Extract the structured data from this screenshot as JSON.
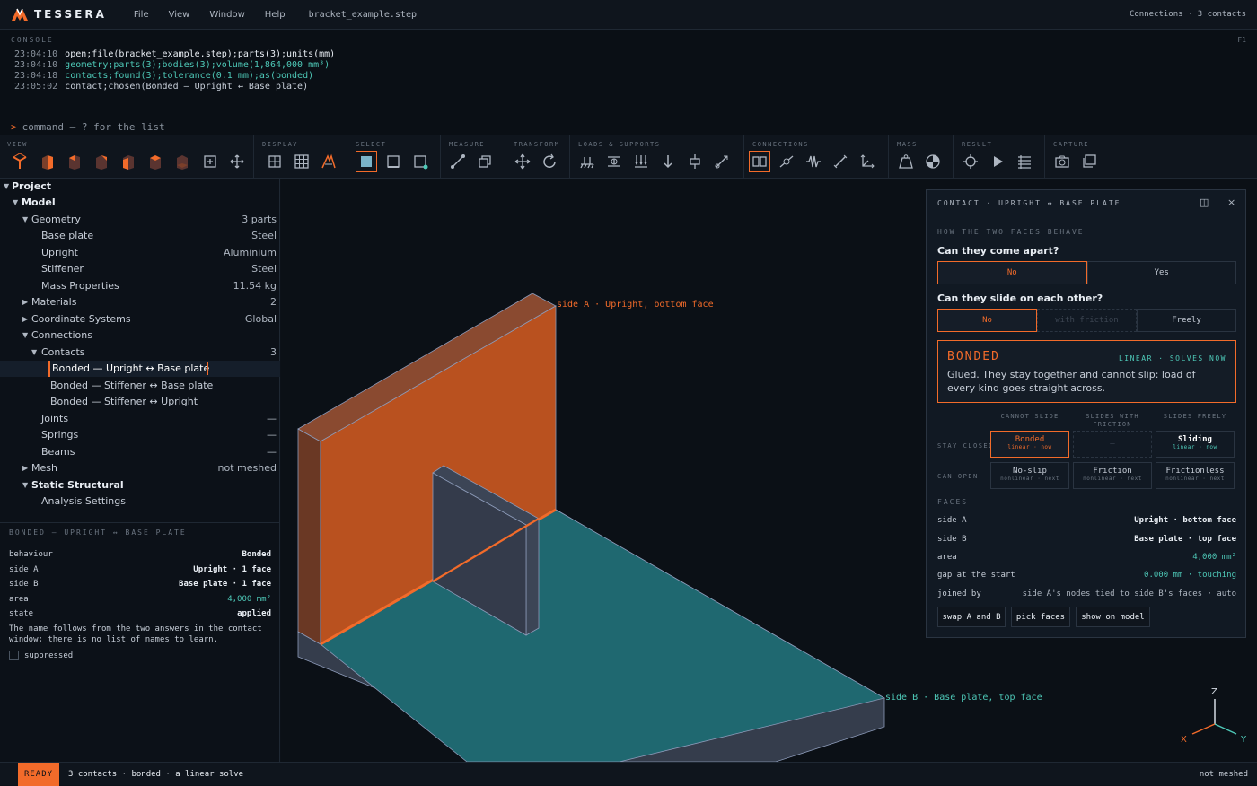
{
  "app": {
    "name": "TESSERA",
    "menus": [
      "File",
      "View",
      "Window",
      "Help"
    ],
    "file": "bracket_example.step",
    "top_right": "Connections · 3 contacts"
  },
  "console": {
    "title": "CONSOLE",
    "key": "F1",
    "lines": [
      {
        "time": "23:04:10",
        "text": "open;file(bracket_example.step);parts(3);units(mm)"
      },
      {
        "time": "23:04:10",
        "text": "geometry;parts(3);bodies(3);volume(1,864,000 mm³)"
      },
      {
        "time": "23:04:18",
        "text": "contacts;found(3);tolerance(0.1 mm);as(bonded)"
      },
      {
        "time": "23:05:02",
        "text": "contact;chosen(Bonded — Upright ↔ Base plate)"
      }
    ],
    "prompt": ">",
    "prompt_placeholder": "command  —  ? for the list"
  },
  "toolbar": {
    "groups": [
      "VIEW",
      "DISPLAY",
      "SELECT",
      "MEASURE",
      "TRANSFORM",
      "LOADS & SUPPORTS",
      "CONNECTIONS",
      "MASS",
      "RESULT",
      "CAPTURE"
    ]
  },
  "tree": [
    {
      "label": "Project",
      "value": ""
    },
    {
      "label": "Model",
      "value": ""
    },
    {
      "label": "Geometry",
      "value": "3 parts"
    },
    {
      "label": "Base plate",
      "value": "Steel"
    },
    {
      "label": "Upright",
      "value": "Aluminium"
    },
    {
      "label": "Stiffener",
      "value": "Steel"
    },
    {
      "label": "Mass Properties",
      "value": "11.54 kg"
    },
    {
      "label": "Materials",
      "value": "2"
    },
    {
      "label": "Coordinate Systems",
      "value": "Global"
    },
    {
      "label": "Connections",
      "value": ""
    },
    {
      "label": "Contacts",
      "value": "3"
    },
    {
      "label": "Bonded — Upright ↔ Base plate",
      "value": ""
    },
    {
      "label": "Bonded — Stiffener ↔ Base plate",
      "value": ""
    },
    {
      "label": "Bonded — Stiffener ↔ Upright",
      "value": ""
    },
    {
      "label": "Joints",
      "value": "—"
    },
    {
      "label": "Springs",
      "value": "—"
    },
    {
      "label": "Beams",
      "value": "—"
    },
    {
      "label": "Mesh",
      "value": "not meshed"
    },
    {
      "label": "Static Structural",
      "value": ""
    },
    {
      "label": "Analysis Settings",
      "value": ""
    }
  ],
  "props": {
    "title": "BONDED — UPRIGHT ↔ BASE PLATE",
    "rows": [
      {
        "k": "behaviour",
        "v": "Bonded"
      },
      {
        "k": "side A",
        "v": "Upright · 1 face"
      },
      {
        "k": "side B",
        "v": "Base plate · 1 face"
      },
      {
        "k": "area",
        "v": "4,000 mm²"
      },
      {
        "k": "state",
        "v": "applied"
      }
    ],
    "note": "The name follows from the two answers in the contact window; there is no list of names to learn.",
    "suppressed": "suppressed"
  },
  "viewport": {
    "label_a": "side A · Upright, bottom face",
    "label_b": "side B · Base plate, top face",
    "axes": {
      "z": "Z",
      "x": "X",
      "y": "Y"
    }
  },
  "panel": {
    "title": "CONTACT · UPRIGHT ↔ BASE PLATE",
    "section1": "HOW THE TWO FACES BEHAVE",
    "q1": "Can they come apart?",
    "q1_opts": [
      "No",
      "Yes"
    ],
    "q2": "Can they slide on each other?",
    "q2_opts": [
      "No",
      "with friction",
      "Freely"
    ],
    "card": {
      "title": "BONDED",
      "tag": "LINEAR · SOLVES NOW",
      "desc": "Glued. They stay together and cannot slip: load of every kind goes straight across."
    },
    "matrix": {
      "cols": [
        "CANNOT SLIDE",
        "SLIDES WITH FRICTION",
        "SLIDES FREELY"
      ],
      "rows": [
        "STAY CLOSED",
        "CAN OPEN"
      ],
      "cells": [
        {
          "a": "Bonded",
          "s": "linear · now"
        },
        {
          "a": "–",
          "s": ""
        },
        {
          "a": "Sliding",
          "s": "linear · now"
        },
        {
          "a": "No-slip",
          "s": "nonlinear · next"
        },
        {
          "a": "Friction",
          "s": "nonlinear · next"
        },
        {
          "a": "Frictionless",
          "s": "nonlinear · next"
        }
      ]
    },
    "faces_title": "FACES",
    "faces": [
      {
        "k": "side A",
        "v": "Upright · bottom face"
      },
      {
        "k": "side B",
        "v": "Base plate · top face"
      },
      {
        "k": "area",
        "v": "4,000 mm²"
      },
      {
        "k": "gap at the start",
        "v": "0.000 mm · touching"
      },
      {
        "k": "joined by",
        "v": "side A's nodes tied to side B's faces · auto"
      }
    ],
    "buttons": [
      "swap A and B",
      "pick faces",
      "show on model"
    ]
  },
  "status": {
    "ready": "READY",
    "message": "3 contacts · bonded · a linear solve",
    "right": "not meshed"
  },
  "colors": {
    "accent": "#f26b2a",
    "teal": "#4ec9b8"
  }
}
